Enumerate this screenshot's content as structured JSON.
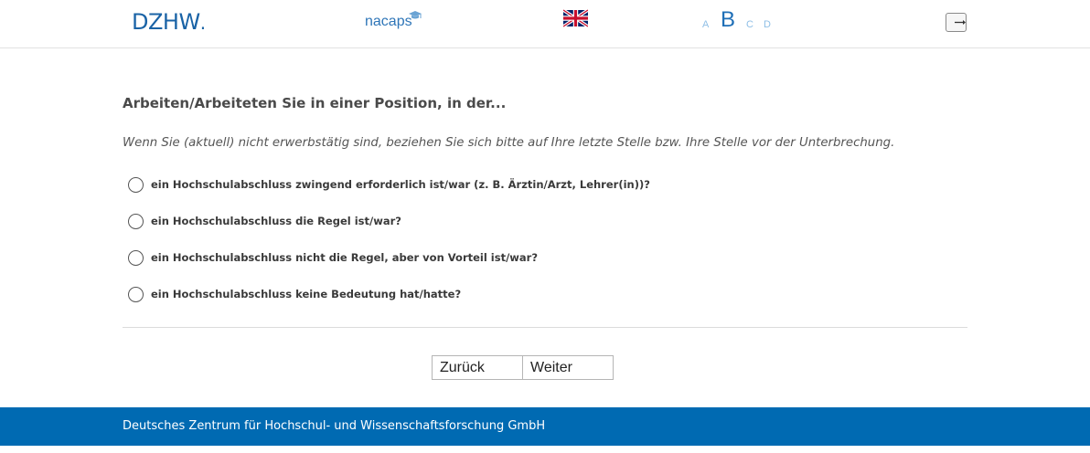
{
  "header": {
    "logo_dzhw": "DZHW",
    "logo_dzhw_dot": ".",
    "logo_nacaps": "nacaps",
    "flag_icon": "uk-flag-icon",
    "text_sizes": [
      {
        "label": "A",
        "active": false
      },
      {
        "label": "B",
        "active": true
      },
      {
        "label": "C",
        "active": false
      },
      {
        "label": "D",
        "active": false
      }
    ],
    "logout_icon": "logout-arrow-icon"
  },
  "main": {
    "question": "Arbeiten/Arbeiteten Sie in einer Position, in der...",
    "instruction": "Wenn Sie (aktuell) nicht erwerbstätig sind, beziehen Sie sich bitte auf Ihre letzte Stelle bzw. Ihre Stelle vor der Unterbrechung.",
    "options": [
      {
        "label": "ein Hochschulabschluss zwingend erforderlich ist/war (z. B. Ärztin/Arzt, Lehrer(in))?"
      },
      {
        "label": "ein Hochschulabschluss die Regel ist/war?"
      },
      {
        "label": "ein Hochschulabschluss nicht die Regel, aber von Vorteil ist/war?"
      },
      {
        "label": "ein Hochschulabschluss keine Bedeutung hat/hatte?"
      }
    ],
    "back_label": "Zurück",
    "next_label": "Weiter"
  },
  "footer": {
    "text": "Deutsches Zentrum für Hochschul- und Wissenschaftsforschung GmbH"
  },
  "colors": {
    "brand_blue": "#006ab2",
    "logo_blue": "#1a63a6"
  }
}
